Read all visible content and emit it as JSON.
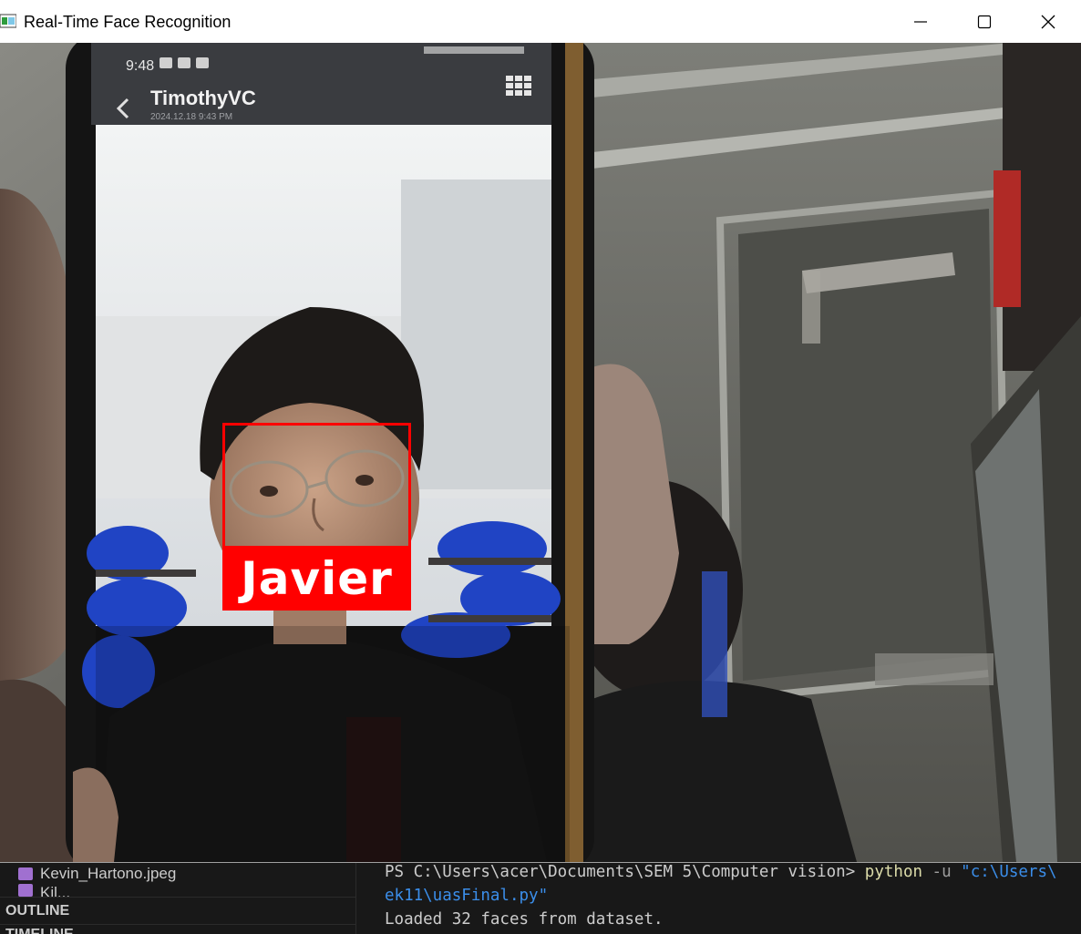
{
  "window": {
    "title": "Real-Time Face Recognition"
  },
  "camera": {
    "phone_status_time": "9:48",
    "phone_contact_name": "TimothyVC",
    "phone_contact_sub": "2024.12.18 9:43 PM",
    "detection_label": "Javier",
    "detection_color": "#ff0000"
  },
  "explorer": {
    "file_1": "Kevin_Hartono.jpeg",
    "file_2": "Kil...",
    "outline_header": "OUTLINE",
    "timeline_header": "TIMELINE"
  },
  "terminal": {
    "line1_prompt": "PS C:\\Users\\acer\\Documents\\SEM 5\\Computer vision> ",
    "line1_cmd": "python",
    "line1_flag": " -u ",
    "line1_arg": "\"c:\\Users\\",
    "line2": "ek11\\uasFinal.py\"",
    "line3": "Loaded 32 faces from dataset."
  }
}
